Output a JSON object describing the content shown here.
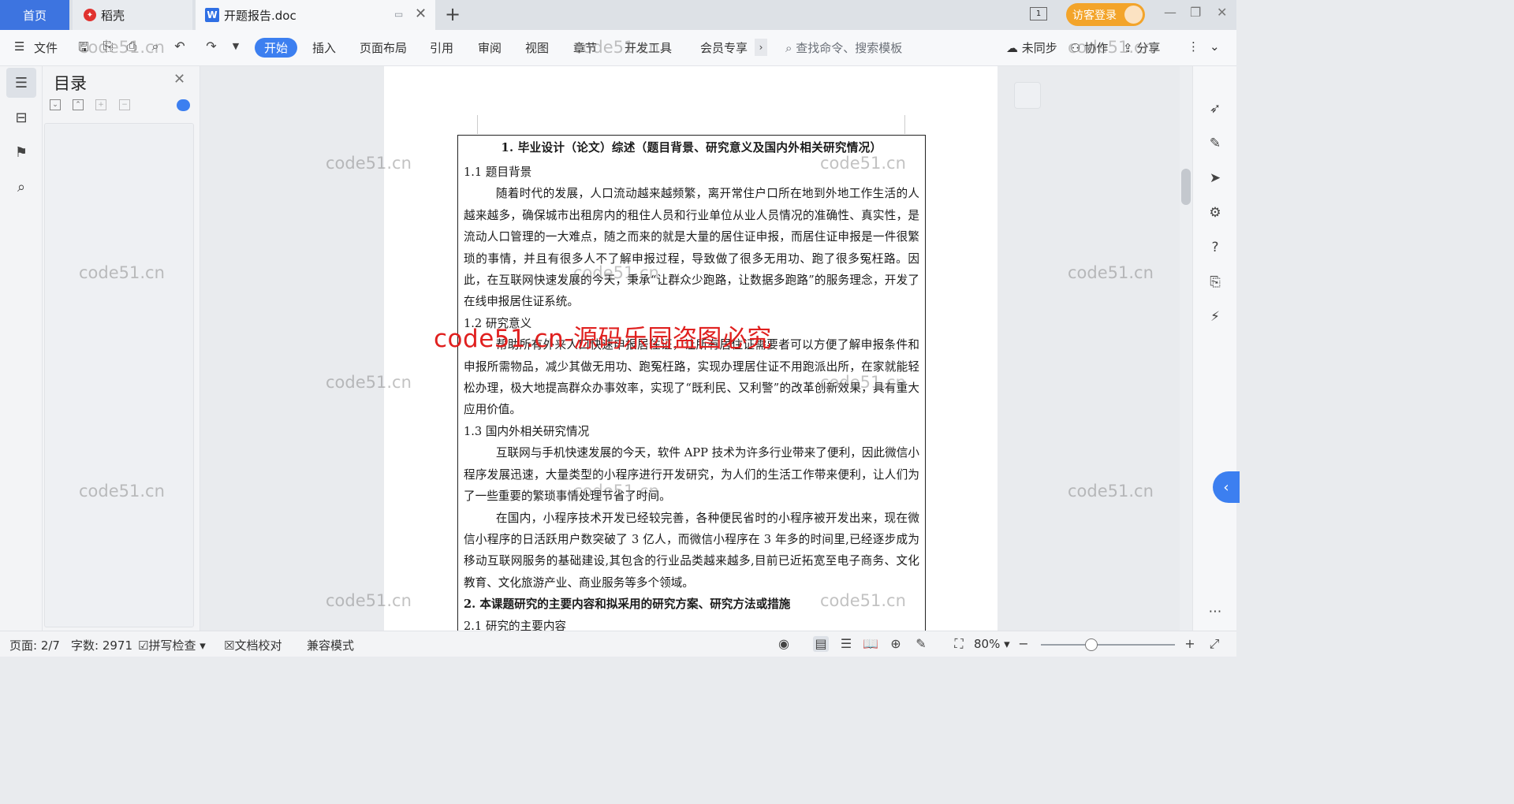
{
  "tabs": {
    "home": "首页",
    "daoke": "稻壳",
    "doc": "开题报告.doc"
  },
  "account": {
    "visitor_login": "访客登录",
    "page_badge": "1"
  },
  "toolbar": {
    "file": "文件",
    "menu": [
      "开始",
      "插入",
      "页面布局",
      "引用",
      "审阅",
      "视图",
      "章节",
      "开发工具",
      "会员专享"
    ],
    "search_placeholder": "查找命令、搜索模板",
    "sync": "未同步",
    "collab": "协作",
    "share": "分享"
  },
  "toc": {
    "title": "目录"
  },
  "document": {
    "heading1": "1. 毕业设计（论文）综述（题目背景、研究意义及国内外相关研究情况）",
    "s11_title": "1.1 题目背景",
    "s11_p1": "随着时代的发展，人口流动越来越频繁，离开常住户口所在地到外地工作生活的人越来越多，确保城市出租房内的租住人员和行业单位从业人员情况的准确性、真实性，是流动人口管理的一大难点，随之而来的就是大量的居住证申报，而居住证申报是一件很繁琐的事情，并且有很多人不了解申报过程，导致做了很多无用功、跑了很多冤枉路。因此，在互联网快速发展的今天，秉承“让群众少跑路，让数据多跑路”的服务理念，开发了在线申报居住证系统。",
    "s12_title": "1.2 研究意义",
    "s12_p1": "帮助所有外来人口快速申报居住证，让所有居住证需要者可以方便了解申报条件和申报所需物品，减少其做无用功、跑冤枉路，实现办理居住证不用跑派出所，在家就能轻松办理，极大地提高群众办事效率，实现了“既利民、又利警”的改革创新效果，具有重大应用价值。",
    "s13_title": "1.3 国内外相关研究情况",
    "s13_p1": "互联网与手机快速发展的今天，软件 APP 技术为许多行业带来了便利，因此微信小程序发展迅速，大量类型的小程序进行开发研究，为人们的生活工作带来便利，让人们为了一些重要的繁琐事情处理节省了时间。",
    "s13_p2": "在国内，小程序技术开发已经较完善，各种便民省时的小程序被开发出来，现在微信小程序的日活跃用户数突破了 3 亿人，而微信小程序在 3 年多的时间里,已经逐步成为移动互联网服务的基础建设,其包含的行业品类越来越多,目前已近拓宽至电子商务、文化教育、文化旅游产业、商业服务等多个领域。",
    "heading2": "2. 本课题研究的主要内容和拟采用的研究方案、研究方法或措施",
    "s21_title": "2.1 研究的主要内容"
  },
  "status": {
    "page": "页面: 2/7",
    "words": "字数: 2971",
    "spell": "拼写检查",
    "proof": "文档校对",
    "compat": "兼容模式",
    "zoom": "80%"
  },
  "watermark": {
    "text": "code51.cn",
    "red": "code51.cn-源码乐园盗图必究"
  },
  "colors": {
    "accent": "#3c7ff0",
    "visitor": "#f3a42a",
    "watermark_red": "#e0201f"
  }
}
